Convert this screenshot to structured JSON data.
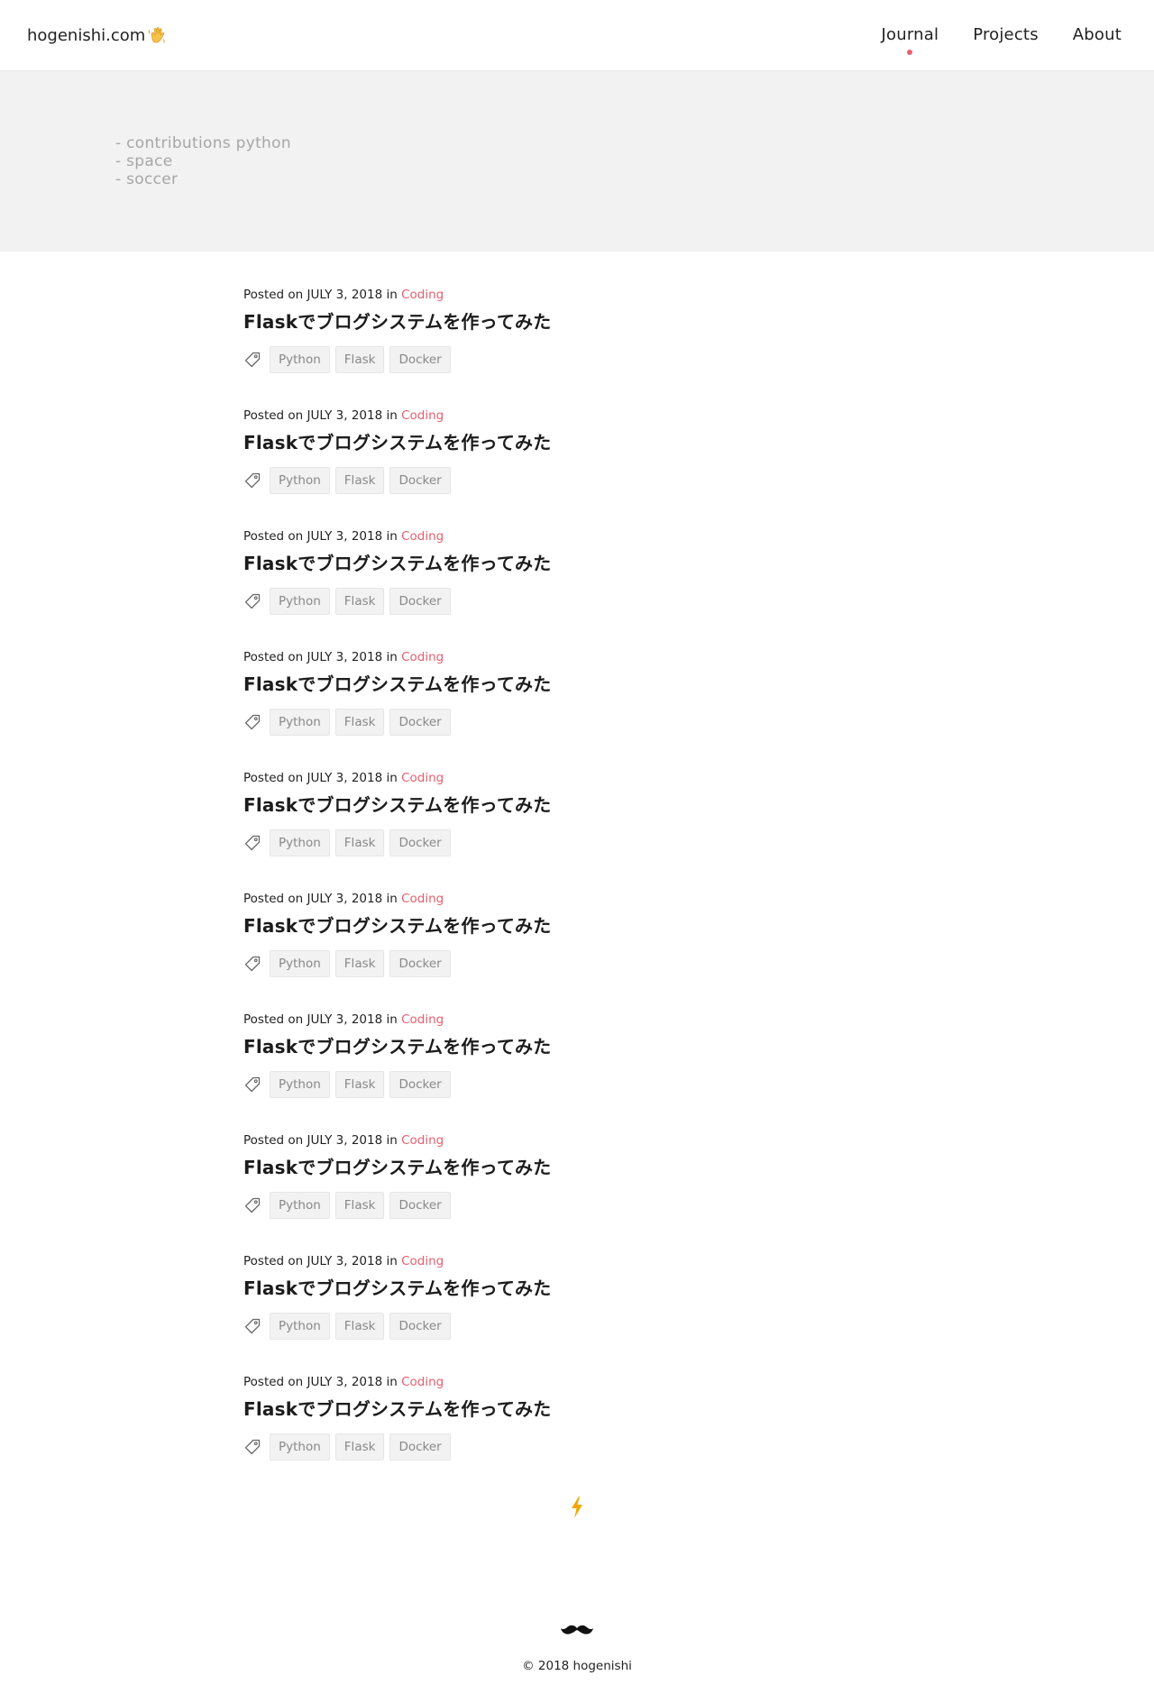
{
  "header": {
    "brand": "hogenishi.com",
    "brand_icon": "waving-hand-icon",
    "nav": [
      {
        "label": "Journal",
        "active": true
      },
      {
        "label": "Projects",
        "active": false
      },
      {
        "label": "About",
        "active": false
      }
    ],
    "accent_color": "#e5606e"
  },
  "hero": {
    "items": [
      "- contributions python",
      "- space",
      "- soccer"
    ]
  },
  "posts": [
    {
      "prefix": "Posted on",
      "date": "JULY 3, 2018",
      "in": "in",
      "category": "Coding",
      "title": "Flaskでブログシステムを作ってみた",
      "tags": [
        "Python",
        "Flask",
        "Docker"
      ]
    },
    {
      "prefix": "Posted on",
      "date": "JULY 3, 2018",
      "in": "in",
      "category": "Coding",
      "title": "Flaskでブログシステムを作ってみた",
      "tags": [
        "Python",
        "Flask",
        "Docker"
      ]
    },
    {
      "prefix": "Posted on",
      "date": "JULY 3, 2018",
      "in": "in",
      "category": "Coding",
      "title": "Flaskでブログシステムを作ってみた",
      "tags": [
        "Python",
        "Flask",
        "Docker"
      ]
    },
    {
      "prefix": "Posted on",
      "date": "JULY 3, 2018",
      "in": "in",
      "category": "Coding",
      "title": "Flaskでブログシステムを作ってみた",
      "tags": [
        "Python",
        "Flask",
        "Docker"
      ]
    },
    {
      "prefix": "Posted on",
      "date": "JULY 3, 2018",
      "in": "in",
      "category": "Coding",
      "title": "Flaskでブログシステムを作ってみた",
      "tags": [
        "Python",
        "Flask",
        "Docker"
      ]
    },
    {
      "prefix": "Posted on",
      "date": "JULY 3, 2018",
      "in": "in",
      "category": "Coding",
      "title": "Flaskでブログシステムを作ってみた",
      "tags": [
        "Python",
        "Flask",
        "Docker"
      ]
    },
    {
      "prefix": "Posted on",
      "date": "JULY 3, 2018",
      "in": "in",
      "category": "Coding",
      "title": "Flaskでブログシステムを作ってみた",
      "tags": [
        "Python",
        "Flask",
        "Docker"
      ]
    },
    {
      "prefix": "Posted on",
      "date": "JULY 3, 2018",
      "in": "in",
      "category": "Coding",
      "title": "Flaskでブログシステムを作ってみた",
      "tags": [
        "Python",
        "Flask",
        "Docker"
      ]
    },
    {
      "prefix": "Posted on",
      "date": "JULY 3, 2018",
      "in": "in",
      "category": "Coding",
      "title": "Flaskでブログシステムを作ってみた",
      "tags": [
        "Python",
        "Flask",
        "Docker"
      ]
    },
    {
      "prefix": "Posted on",
      "date": "JULY 3, 2018",
      "in": "in",
      "category": "Coding",
      "title": "Flaskでブログシステムを作ってみた",
      "tags": [
        "Python",
        "Flask",
        "Docker"
      ]
    }
  ],
  "load_more_icon": "lightning-bolt-icon",
  "bolt_color": "#f0a800",
  "footer": {
    "icon": "mustache-icon",
    "copyright": "© 2018 hogenishi"
  }
}
